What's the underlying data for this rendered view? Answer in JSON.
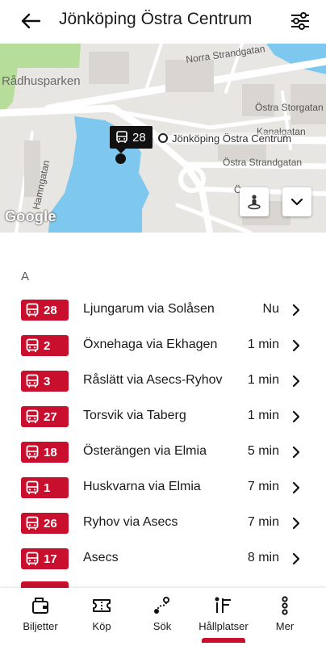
{
  "header": {
    "title": "Jönköping Östra Centrum",
    "back_icon": "arrow-left-icon",
    "filter_icon": "sliders-icon"
  },
  "map": {
    "park_label": "Rådhusparken",
    "street_labels": {
      "norra_strandgatan": "Norra Strandgatan",
      "ostra_storgatan": "Östra Storgatan",
      "kanalgatan": "Kanalgatan",
      "ostra_strandgatan": "Östra Strandgatan",
      "hamngatan": "Hamngatan",
      "partial": "Ö"
    },
    "bus_callout_line": "28",
    "stop_label": "Jönköping Östra Centrum",
    "attribution": "Google"
  },
  "section_letter": "A",
  "departures": [
    {
      "line": "28",
      "destination": "Ljungarum via Solåsen",
      "eta": "Nu"
    },
    {
      "line": "2",
      "destination": "Öxnehaga via Ekhagen",
      "eta": "1 min"
    },
    {
      "line": "3",
      "destination": "Råslätt via Asecs-Ryhov",
      "eta": "1 min"
    },
    {
      "line": "27",
      "destination": "Torsvik via Taberg",
      "eta": "1 min"
    },
    {
      "line": "18",
      "destination": "Österängen via Elmia",
      "eta": "5 min"
    },
    {
      "line": "1",
      "destination": "Huskvarna via Elmia",
      "eta": "7 min"
    },
    {
      "line": "26",
      "destination": "Ryhov via Asecs",
      "eta": "7 min"
    },
    {
      "line": "17",
      "destination": "Asecs",
      "eta": "8 min"
    }
  ],
  "nav": {
    "items": [
      {
        "label": "Biljetter",
        "icon": "wallet-ticket-icon"
      },
      {
        "label": "Köp",
        "icon": "ticket-icon"
      },
      {
        "label": "Sök",
        "icon": "route-search-icon"
      },
      {
        "label": "Hållplatser",
        "icon": "stops-icon"
      },
      {
        "label": "Mer",
        "icon": "more-vertical-icon"
      }
    ],
    "active_index": 3
  },
  "colors": {
    "accent": "#c8102e",
    "water": "#7ec8f0",
    "park": "#b6dd9a"
  }
}
